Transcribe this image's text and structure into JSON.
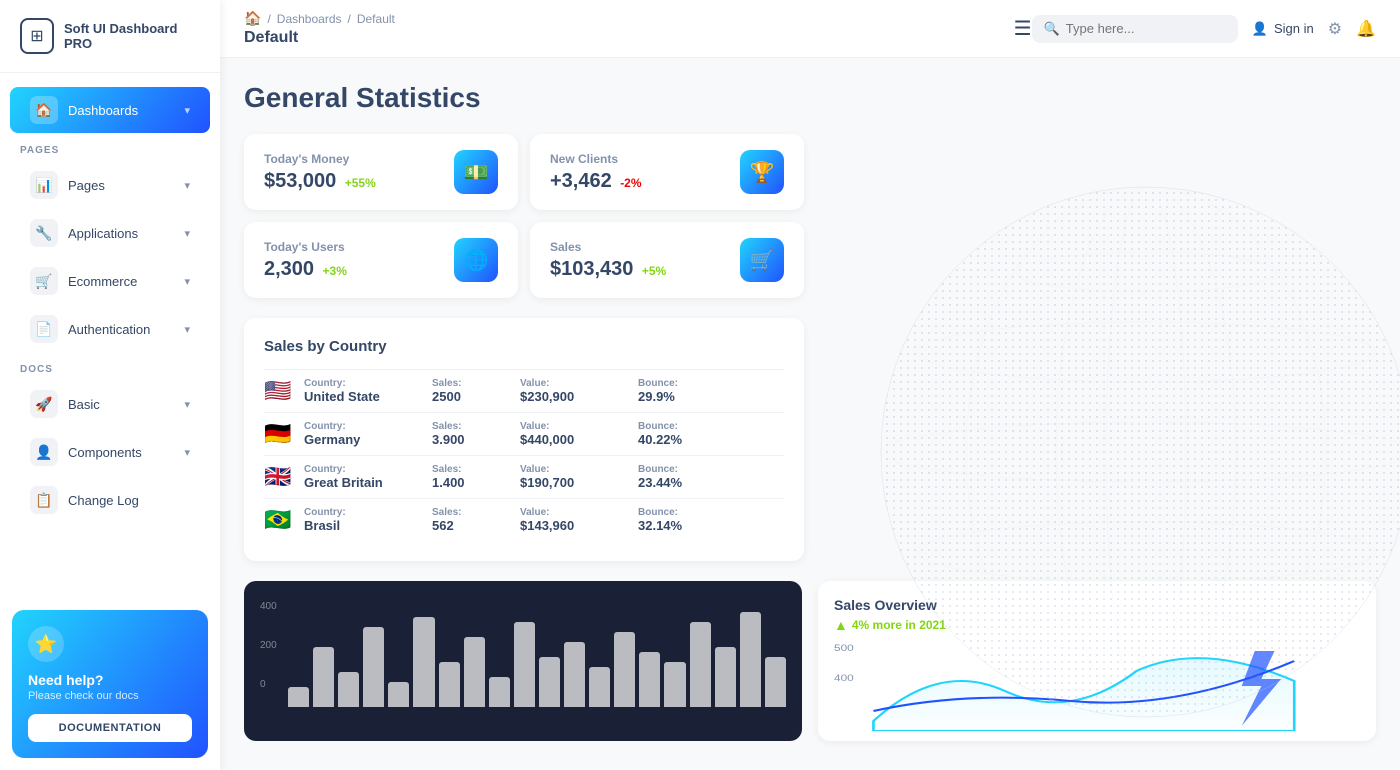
{
  "brand": {
    "name": "Soft UI Dashboard PRO",
    "logo_icon": "⊞"
  },
  "sidebar": {
    "sections": [
      {
        "items": [
          {
            "id": "dashboards",
            "label": "Dashboards",
            "icon": "🏠",
            "active": true,
            "has_chevron": true
          }
        ]
      },
      {
        "label": "PAGES",
        "items": [
          {
            "id": "pages",
            "label": "Pages",
            "icon": "📊",
            "active": false,
            "has_chevron": true
          },
          {
            "id": "applications",
            "label": "Applications",
            "icon": "🔧",
            "active": false,
            "has_chevron": true
          },
          {
            "id": "ecommerce",
            "label": "Ecommerce",
            "icon": "🛒",
            "active": false,
            "has_chevron": true
          },
          {
            "id": "authentication",
            "label": "Authentication",
            "icon": "📄",
            "active": false,
            "has_chevron": true
          }
        ]
      },
      {
        "label": "DOCS",
        "items": [
          {
            "id": "basic",
            "label": "Basic",
            "icon": "🚀",
            "active": false,
            "has_chevron": true
          },
          {
            "id": "components",
            "label": "Components",
            "icon": "👤",
            "active": false,
            "has_chevron": true
          },
          {
            "id": "changelog",
            "label": "Change Log",
            "icon": "📋",
            "active": false,
            "has_chevron": false
          }
        ]
      }
    ],
    "help": {
      "title": "Need help?",
      "subtitle": "Please check our docs",
      "button_label": "DOCUMENTATION",
      "star": "⭐"
    }
  },
  "header": {
    "home_icon": "🏠",
    "breadcrumbs": [
      "Dashboards",
      "Default"
    ],
    "current_page": "Default",
    "menu_icon": "☰",
    "search_placeholder": "Type here...",
    "sign_in_label": "Sign in",
    "gear_icon": "⚙",
    "bell_icon": "🔔",
    "user_icon": "👤"
  },
  "page": {
    "title": "General Statistics"
  },
  "stats": [
    {
      "label": "Today's Money",
      "value": "$53,000",
      "change": "+55%",
      "change_type": "pos",
      "icon": "💵"
    },
    {
      "label": "New Clients",
      "value": "+3,462",
      "change": "-2%",
      "change_type": "neg",
      "icon": "🏆"
    },
    {
      "label": "Today's Users",
      "value": "2,300",
      "change": "+3%",
      "change_type": "pos",
      "icon": "🌐"
    },
    {
      "label": "Sales",
      "value": "$103,430",
      "change": "+5%",
      "change_type": "pos",
      "icon": "🛒"
    }
  ],
  "sales_by_country": {
    "title": "Sales by Country",
    "columns": [
      "Country:",
      "Sales:",
      "Value:",
      "Bounce:"
    ],
    "rows": [
      {
        "flag": "🇺🇸",
        "country": "United State",
        "sales": "2500",
        "value": "$230,900",
        "bounce": "29.9%"
      },
      {
        "flag": "🇩🇪",
        "country": "Germany",
        "sales": "3.900",
        "value": "$440,000",
        "bounce": "40.22%"
      },
      {
        "flag": "🇬🇧",
        "country": "Great Britain",
        "sales": "1.400",
        "value": "$190,700",
        "bounce": "23.44%"
      },
      {
        "flag": "🇧🇷",
        "country": "Brasil",
        "sales": "562",
        "value": "$143,960",
        "bounce": "32.14%"
      }
    ]
  },
  "bar_chart": {
    "y_labels": [
      "400",
      "200",
      "0"
    ],
    "bars": [
      20,
      60,
      35,
      80,
      25,
      90,
      45,
      70,
      30,
      85,
      50,
      65,
      40,
      75,
      55,
      45,
      85,
      60,
      95,
      50
    ]
  },
  "sales_overview": {
    "title": "Sales Overview",
    "subtitle": "4% more in 2021",
    "y_labels": [
      "500",
      "400"
    ]
  }
}
